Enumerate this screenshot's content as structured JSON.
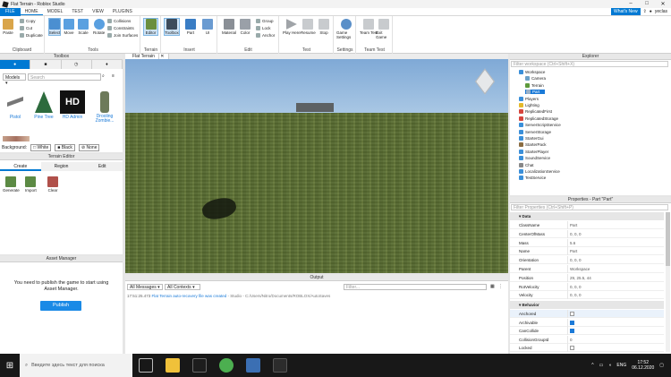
{
  "window": {
    "title": "Flat Terrain - Roblox Studio",
    "user_name": "yeclas"
  },
  "menu": {
    "file": "FILE",
    "tabs": [
      "HOME",
      "MODEL",
      "TEST",
      "VIEW",
      "PLUGINS"
    ],
    "whats_new": "What's New"
  },
  "ribbon": {
    "clipboard": {
      "label": "Clipboard",
      "paste": "Paste",
      "copy": "Copy",
      "cut": "Cut",
      "duplicate": "Duplicate"
    },
    "tools": {
      "label": "Tools",
      "select": "Select",
      "move": "Move",
      "scale": "Scale",
      "rotate": "Rotate",
      "collisions": "Collisions",
      "constraints": "Constraints",
      "join_surfaces": "Join Surfaces"
    },
    "terrain": {
      "label": "Terrain",
      "editor": "Editor"
    },
    "insert": {
      "label": "Insert",
      "toolbox": "Toolbox",
      "part": "Part",
      "ui": "UI"
    },
    "edit": {
      "label": "Edit",
      "material": "Material",
      "color": "Color",
      "group": "Group",
      "lock": "Lock",
      "anchor": "Anchor"
    },
    "test": {
      "label": "Test",
      "play": "Play Here",
      "resume": "Resume",
      "stop": "Stop"
    },
    "settings": {
      "label": "Settings",
      "game_settings": "Game Settings"
    },
    "team_test": {
      "label": "Team Test",
      "team_test": "Team Test",
      "exit_game": "Exit Game"
    }
  },
  "toolbox": {
    "title": "Toolbox",
    "category": "Models",
    "search_placeholder": "Search",
    "items": [
      {
        "name": "Pistol"
      },
      {
        "name": "Pine Tree"
      },
      {
        "name": "HD Admin"
      },
      {
        "name": "Drooling Zombie..."
      }
    ],
    "background_label": "Background:",
    "bg_options": [
      "White",
      "Black",
      "None"
    ]
  },
  "terrain_editor": {
    "title": "Terrain Editor",
    "tabs": [
      "Create",
      "Region",
      "Edit"
    ],
    "tools": [
      "Generate",
      "Import",
      "Clear"
    ]
  },
  "asset_manager": {
    "title": "Asset Manager",
    "message": "You need to publish the game to start using Asset Manager.",
    "publish": "Publish"
  },
  "viewport": {
    "tab": "Flat Terrain"
  },
  "output": {
    "title": "Output",
    "filter1": "All Messages",
    "filter2": "All Contexts",
    "filter_placeholder": "Filter...",
    "line_time": "17:51:25.473",
    "line_text": "Flat Terrain auto-recovery file was created",
    "line_tail": "- Studio - C:/Users/Nitro/Documents/ROBLOX/AutoSaves"
  },
  "explorer": {
    "title": "Explorer",
    "filter_placeholder": "Filter workspace (Ctrl+Shift+X)",
    "items": [
      {
        "label": "Workspace",
        "indent": 0,
        "color": "#3a8fd9"
      },
      {
        "label": "Camera",
        "indent": 1,
        "color": "#6aa0c8"
      },
      {
        "label": "Terrain",
        "indent": 1,
        "color": "#5d9a3c"
      },
      {
        "label": "Part",
        "indent": 1,
        "color": "#9ab1c8",
        "selected": true
      },
      {
        "label": "Players",
        "indent": 0,
        "color": "#3a8fd9"
      },
      {
        "label": "Lighting",
        "indent": 0,
        "color": "#e4b92b"
      },
      {
        "label": "ReplicatedFirst",
        "indent": 0,
        "color": "#d6453d"
      },
      {
        "label": "ReplicatedStorage",
        "indent": 0,
        "color": "#d6453d"
      },
      {
        "label": "ServerScriptService",
        "indent": 0,
        "color": "#3a8fd9"
      },
      {
        "label": "ServerStorage",
        "indent": 0,
        "color": "#3a8fd9"
      },
      {
        "label": "StarterGui",
        "indent": 0,
        "color": "#3a8fd9"
      },
      {
        "label": "StarterPack",
        "indent": 0,
        "color": "#8a6c42"
      },
      {
        "label": "StarterPlayer",
        "indent": 0,
        "color": "#3a8fd9"
      },
      {
        "label": "SoundService",
        "indent": 0,
        "color": "#3a8fd9"
      },
      {
        "label": "Chat",
        "indent": 0,
        "color": "#888888"
      },
      {
        "label": "LocalizationService",
        "indent": 0,
        "color": "#3a8fd9"
      },
      {
        "label": "TestService",
        "indent": 0,
        "color": "#3a8fd9"
      }
    ]
  },
  "properties": {
    "title": "Properties - Part \"Part\"",
    "filter_placeholder": "Filter Properties (Ctrl+Shift+P)",
    "sections": {
      "data": "Data",
      "behavior": "Behavior"
    },
    "rows": [
      {
        "key": "ClassName",
        "value": "Part"
      },
      {
        "key": "CenterOfMass",
        "value": "0, 0, 0"
      },
      {
        "key": "Mass",
        "value": "5.6"
      },
      {
        "key": "Name",
        "value": "Part"
      },
      {
        "key": "Orientation",
        "value": "0, 0, 0"
      },
      {
        "key": "Parent",
        "value": "Workspace"
      },
      {
        "key": "Position",
        "value": "29, 25.5, 44"
      },
      {
        "key": "RotVelocity",
        "value": "0, 0, 0"
      },
      {
        "key": "Velocity",
        "value": "0, 0, 0"
      }
    ],
    "behavior_rows": [
      {
        "key": "Anchored",
        "checked": false
      },
      {
        "key": "Archivable",
        "checked": true
      },
      {
        "key": "CanCollide",
        "checked": true
      },
      {
        "key": "CollisionGroupId",
        "value": "0"
      },
      {
        "key": "Locked",
        "checked": false
      }
    ]
  },
  "taskbar": {
    "search": "Введите здесь текст для поиска",
    "lang": "ENG",
    "time": "17:52",
    "date": "06.12.2020"
  }
}
